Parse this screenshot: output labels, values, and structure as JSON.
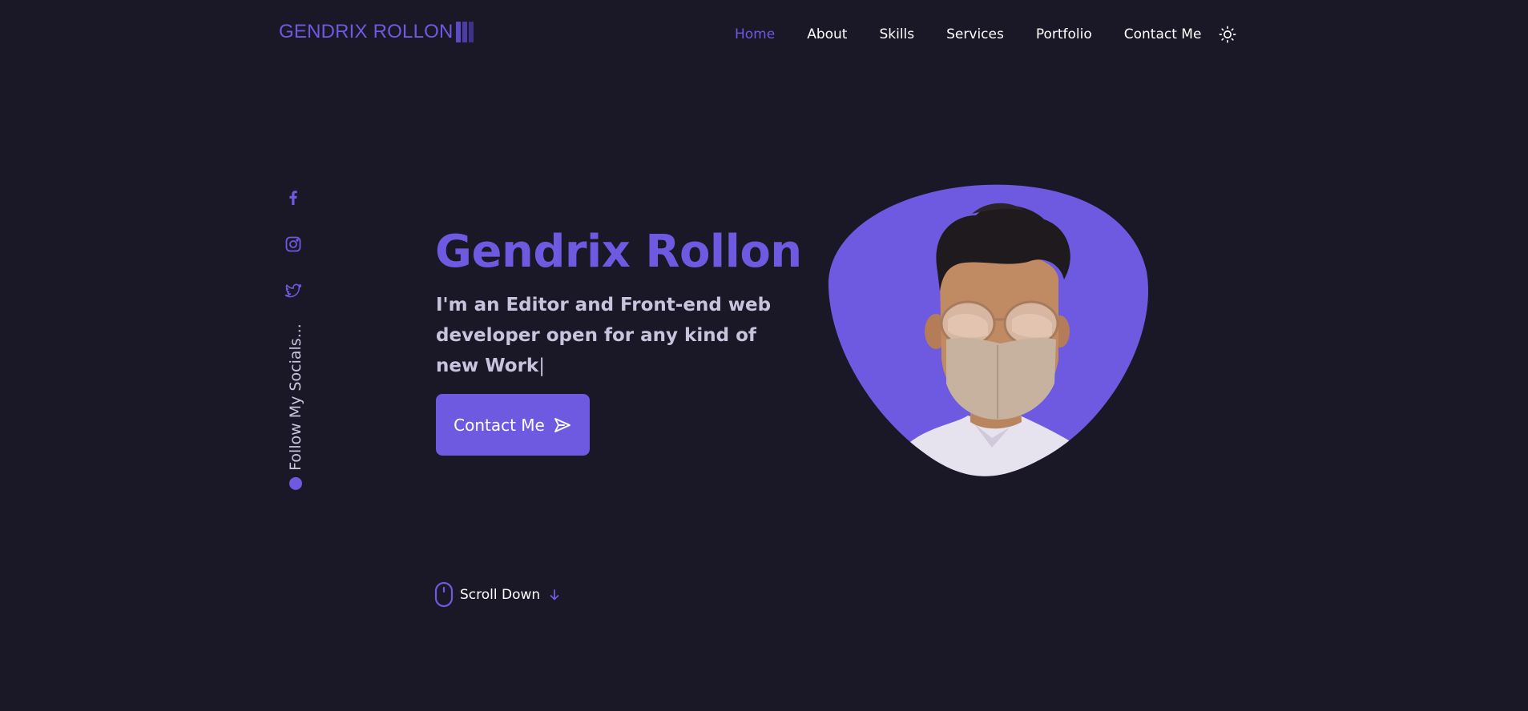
{
  "header": {
    "logo_text": "GENDRIX ROLLON",
    "nav": [
      {
        "label": "Home",
        "active": true
      },
      {
        "label": "About"
      },
      {
        "label": "Skills"
      },
      {
        "label": "Services"
      },
      {
        "label": "Portfolio"
      },
      {
        "label": "Contact Me"
      }
    ],
    "theme_toggle_icon": "sun-icon"
  },
  "socials": {
    "icons": [
      "facebook-icon",
      "instagram-icon",
      "twitter-icon"
    ],
    "follow_label": "Follow My Socials..."
  },
  "hero": {
    "title": "Gendrix Rollon",
    "subtitle": "I'm an Editor and Front-end web developer open for any kind of new Work",
    "cursor": "|",
    "cta_label": "Contact Me",
    "cta_icon": "send-icon",
    "portrait_icon": "profile-photo"
  },
  "scroll": {
    "label": "Scroll Down",
    "icons": [
      "mouse-icon",
      "arrow-down-icon"
    ]
  },
  "colors": {
    "background": "#1a1727",
    "accent": "#6d5ae0",
    "text": "#ffffff",
    "muted_text": "#c9c4de"
  }
}
